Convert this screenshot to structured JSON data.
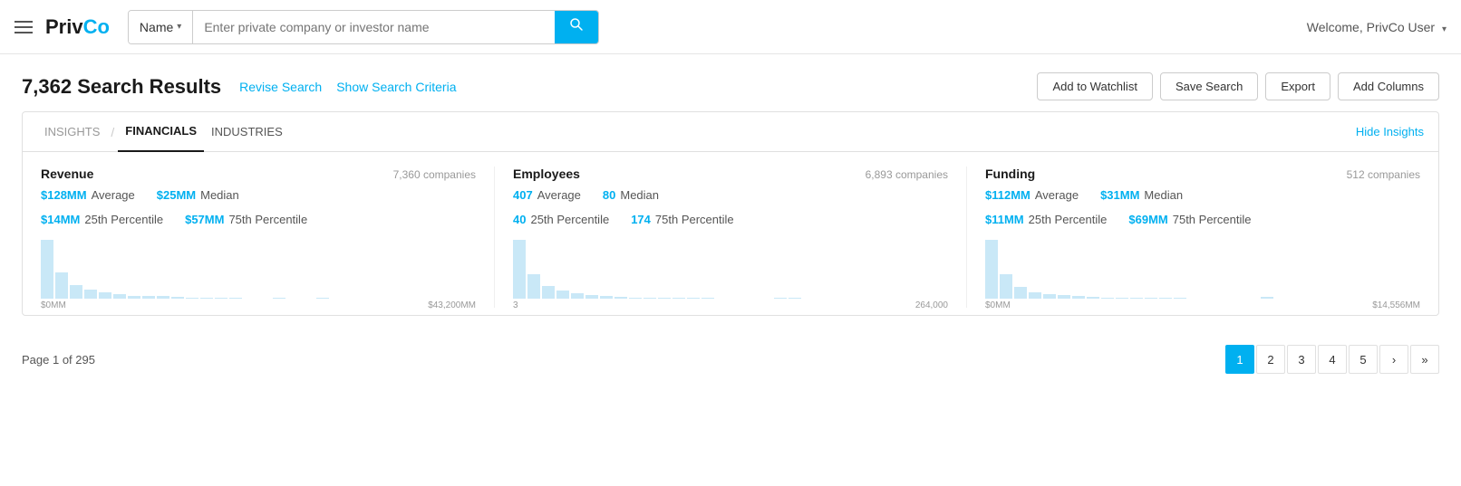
{
  "navbar": {
    "hamburger_label": "Menu",
    "logo_priv": "Priv",
    "logo_co": "Co",
    "search_type": "Name",
    "search_placeholder": "Enter private company or investor name",
    "search_button_label": "Search",
    "welcome": "Welcome, PrivCo User"
  },
  "results": {
    "count": "7,362",
    "count_label": "Search Results",
    "revise_search": "Revise Search",
    "show_criteria": "Show Search Criteria",
    "add_watchlist": "Add to Watchlist",
    "save_search": "Save Search",
    "export": "Export",
    "add_columns": "Add Columns"
  },
  "insights": {
    "tab_insights": "INSIGHTS",
    "tab_financials": "FINANCIALS",
    "tab_industries": "INDUSTRIES",
    "hide_insights": "Hide Insights",
    "revenue": {
      "title": "Revenue",
      "companies": "7,360 companies",
      "average_value": "$128MM",
      "average_label": "Average",
      "percentile25_value": "$14MM",
      "percentile25_label": "25th Percentile",
      "median_value": "$25MM",
      "median_label": "Median",
      "percentile75_value": "$57MM",
      "percentile75_label": "75th Percentile",
      "axis_min": "$0MM",
      "axis_max": "$43,200MM",
      "bars": [
        95,
        42,
        22,
        14,
        10,
        8,
        5,
        4,
        4,
        3,
        2,
        2,
        1,
        2,
        0,
        0,
        1,
        0,
        0,
        2
      ]
    },
    "employees": {
      "title": "Employees",
      "companies": "6,893 companies",
      "average_value": "407",
      "average_label": "Average",
      "percentile25_value": "40",
      "percentile25_label": "25th Percentile",
      "median_value": "80",
      "median_label": "Median",
      "percentile75_value": "174",
      "percentile75_label": "75th Percentile",
      "axis_min": "3",
      "axis_max": "264,000",
      "bars": [
        90,
        38,
        20,
        12,
        8,
        6,
        4,
        3,
        2,
        2,
        1,
        1,
        1,
        1,
        0,
        0,
        0,
        0,
        1,
        2
      ]
    },
    "funding": {
      "title": "Funding",
      "companies": "512 companies",
      "average_value": "$112MM",
      "average_label": "Average",
      "percentile25_value": "$11MM",
      "percentile25_label": "25th Percentile",
      "median_value": "$31MM",
      "median_label": "Median",
      "percentile75_value": "$69MM",
      "percentile75_label": "75th Percentile",
      "axis_min": "$0MM",
      "axis_max": "$14,556MM",
      "bars": [
        88,
        36,
        18,
        10,
        7,
        5,
        4,
        3,
        2,
        2,
        1,
        1,
        1,
        1,
        0,
        0,
        0,
        0,
        0,
        3
      ]
    }
  },
  "pagination": {
    "page_info": "Page 1 of 295",
    "pages": [
      "1",
      "2",
      "3",
      "4",
      "5"
    ],
    "next": "›",
    "last": "»"
  }
}
